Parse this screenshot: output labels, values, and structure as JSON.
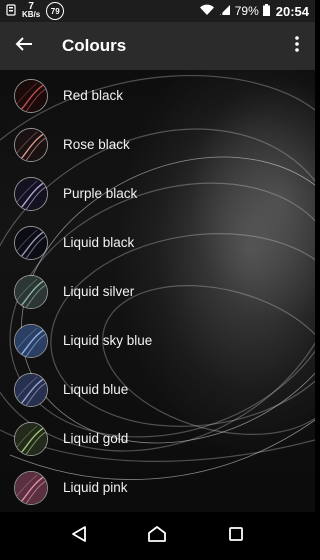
{
  "status_bar": {
    "speed_value": "7",
    "speed_unit": "KB/s",
    "notification_count": "79",
    "battery_percent": "79%",
    "time": "20:54",
    "icons": [
      "usb-icon",
      "wifi-icon",
      "signal-icon",
      "battery-icon"
    ]
  },
  "app_bar": {
    "title": "Colours",
    "back_icon": "arrow-back-icon",
    "menu_icon": "more-vert-icon"
  },
  "colours": [
    {
      "label": "Red black",
      "accent": "#c0504d",
      "base": "#1a0a0a"
    },
    {
      "label": "Rose black",
      "accent": "#d9968a",
      "base": "#1a1212"
    },
    {
      "label": "Purple black",
      "accent": "#b7a6d6",
      "base": "#141220"
    },
    {
      "label": "Liquid black",
      "accent": "#9a9fb8",
      "base": "#0c0c14"
    },
    {
      "label": "Liquid silver",
      "accent": "#8fb5a8",
      "base": "#2c3634"
    },
    {
      "label": "Liquid sky blue",
      "accent": "#8fb2e6",
      "base": "#2b3e63"
    },
    {
      "label": "Liquid blue",
      "accent": "#9aa5cc",
      "base": "#283050"
    },
    {
      "label": "Liquid gold",
      "accent": "#9fc47a",
      "base": "#232a1c"
    },
    {
      "label": "Liquid pink",
      "accent": "#e08fa8",
      "base": "#5a3040"
    }
  ],
  "nav_bar": {
    "icons": [
      "back-triangle-icon",
      "home-icon",
      "recents-icon"
    ]
  }
}
